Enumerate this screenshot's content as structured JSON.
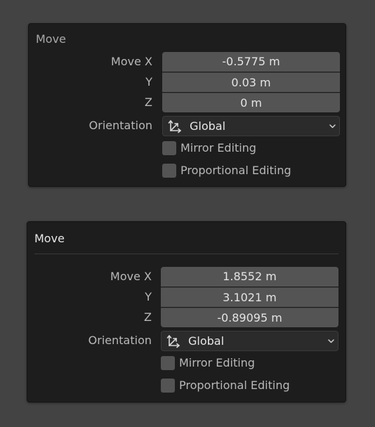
{
  "panels": [
    {
      "title": "Move",
      "move_label": "Move X",
      "y_label": "Y",
      "z_label": "Z",
      "values": {
        "x": "-0.5775 m",
        "y": "0.03 m",
        "z": "0 m"
      },
      "orientation_label": "Orientation",
      "orientation_value": "Global",
      "mirror_editing": {
        "label": "Mirror Editing",
        "checked": false
      },
      "proportional_editing": {
        "label": "Proportional Editing",
        "checked": false
      }
    },
    {
      "title": "Move",
      "move_label": "Move X",
      "y_label": "Y",
      "z_label": "Z",
      "values": {
        "x": "1.8552 m",
        "y": "3.1021 m",
        "z": "-0.89095 m"
      },
      "orientation_label": "Orientation",
      "orientation_value": "Global",
      "mirror_editing": {
        "label": "Mirror Editing",
        "checked": false
      },
      "proportional_editing": {
        "label": "Proportional Editing",
        "checked": false
      }
    }
  ],
  "icons": {
    "orientation": "axis-gizmo-icon",
    "dropdown": "chevron-down-icon"
  },
  "colors": {
    "background": "#434343",
    "panel": "#1d1d1d",
    "field": "#545454",
    "dropdown": "#2b2b2b"
  }
}
